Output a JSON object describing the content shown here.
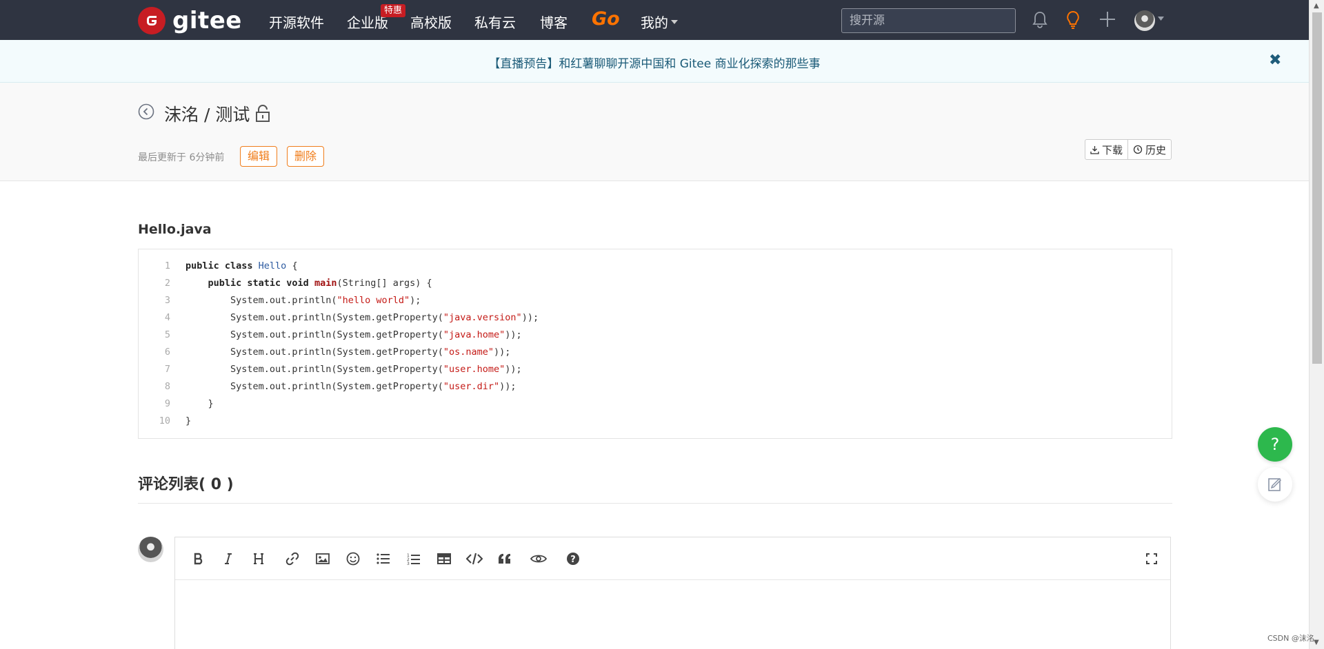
{
  "nav": {
    "logo_text": "gitee",
    "items": [
      "开源软件",
      "企业版",
      "高校版",
      "私有云",
      "博客"
    ],
    "badge": "特惠",
    "go": "Go",
    "mine": "我的",
    "search_placeholder": "搜开源"
  },
  "announcement": {
    "text": "【直播预告】和红薯聊聊开源中国和 Gitee 商业化探索的那些事",
    "close": "✖"
  },
  "header": {
    "title": "沫洺 / 测试",
    "updated": "最后更新于 6分钟前",
    "edit": "编辑",
    "delete": "删除",
    "download": "下载",
    "history": "历史"
  },
  "file": {
    "name": "Hello.java",
    "lines": [
      "1",
      "2",
      "3",
      "4",
      "5",
      "6",
      "7",
      "8",
      "9",
      "10"
    ]
  },
  "code": {
    "l1_kw": "public class ",
    "l1_cls": "Hello",
    "l1_rest": " {",
    "l2_kw": "public static void ",
    "l2_fn": "main",
    "l2_rest": "(String[] args) {",
    "call": "System.out.println(",
    "getprop": "System.out.println(System.getProperty(",
    "s3": "\"hello world\"",
    "s4": "\"java.version\"",
    "s5": "\"java.home\"",
    "s6": "\"os.name\"",
    "s7": "\"user.home\"",
    "s8": "\"user.dir\"",
    "end1": ");",
    "end2": "));",
    "close": "}"
  },
  "comments": {
    "title": "评论列表( 0 )"
  },
  "float": {
    "help": "?"
  },
  "watermark": "CSDN @沫洺"
}
